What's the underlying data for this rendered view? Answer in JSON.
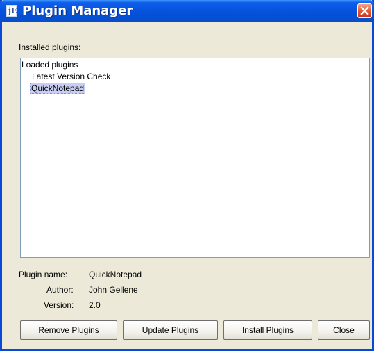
{
  "window": {
    "title": "Plugin Manager",
    "app_icon_glyph": "jE"
  },
  "installed_label": "Installed plugins:",
  "tree": {
    "root": "Loaded plugins",
    "children": [
      {
        "label": "Latest Version Check",
        "selected": false
      },
      {
        "label": "QuickNotepad",
        "selected": true
      }
    ]
  },
  "details": {
    "name_label": "Plugin name:",
    "name_value": "QuickNotepad",
    "author_label": "Author:",
    "author_value": "John Gellene",
    "version_label": "Version:",
    "version_value": "2.0"
  },
  "buttons": {
    "remove": "Remove Plugins",
    "update": "Update Plugins",
    "install": "Install Plugins",
    "close": "Close"
  },
  "colors": {
    "title_bar": "#0654e0",
    "window_bg": "#ece9d8",
    "selection_bg": "#c8cdf4",
    "close_button": "#e1552f"
  },
  "icons": {
    "app": "jedit-app-icon",
    "close": "close-icon"
  }
}
